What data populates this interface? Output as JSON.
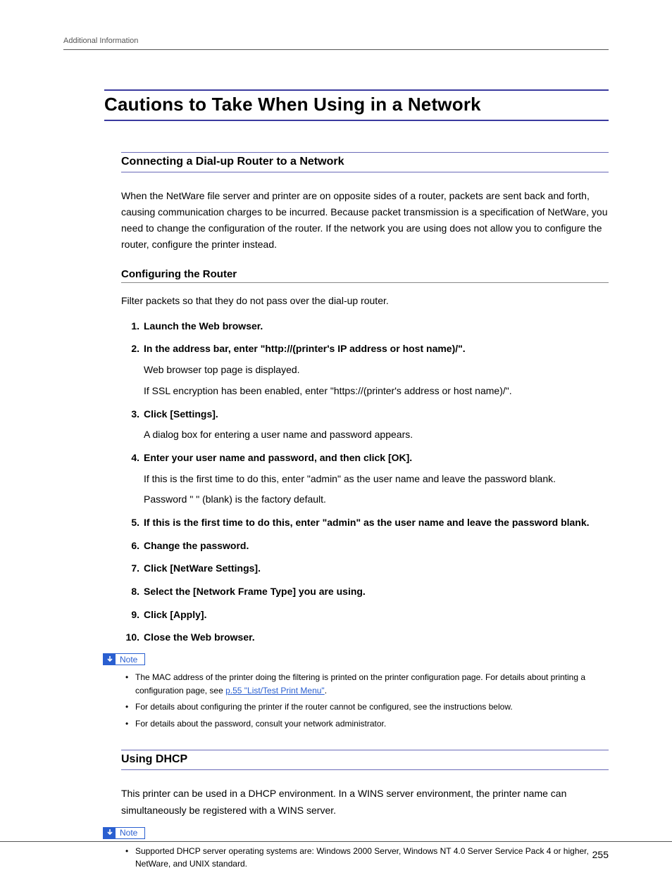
{
  "header": {
    "breadcrumb": "Additional Information"
  },
  "title": "Cautions to Take When Using in a Network",
  "section1": {
    "heading": "Connecting a Dial-up Router to a Network",
    "para": "When the NetWare file server and printer are on opposite sides of a router, packets are sent back and forth, causing communication charges to be incurred. Because packet transmission is a specification of NetWare, you need to change the configuration of the router. If the network you are using does not allow you to configure the router, configure the printer instead."
  },
  "section1sub": {
    "heading": "Configuring the Router",
    "intro": "Filter packets so that they do not pass over the dial-up router.",
    "steps": [
      {
        "head": "Launch the Web browser."
      },
      {
        "head": "In the address bar, enter \"http://(printer's IP address or host name)/\".",
        "subs": [
          "Web browser top page is displayed.",
          "If SSL encryption has been enabled, enter \"https://(printer's address or host name)/\"."
        ]
      },
      {
        "head": "Click [Settings].",
        "subs": [
          "A dialog box for entering a user name and password appears."
        ]
      },
      {
        "head": "Enter your user name and password, and then click [OK].",
        "subs": [
          "If this is the first time to do this, enter \"admin\" as the user name and leave the password blank.",
          "Password \" \" (blank) is the factory default."
        ]
      },
      {
        "head": "If this is the first time to do this, enter \"admin\" as the user name and leave the password blank."
      },
      {
        "head": "Change the password."
      },
      {
        "head": "Click [NetWare Settings]."
      },
      {
        "head": "Select the [Network Frame Type] you are using."
      },
      {
        "head": "Click [Apply]."
      },
      {
        "head": "Close the Web browser."
      }
    ]
  },
  "note_label": "Note",
  "note1": {
    "items": [
      {
        "pre": "The MAC address of the printer doing the filtering is printed on the printer configuration page. For details about printing a configuration page, see ",
        "link": "p.55 \"List/Test Print Menu\"",
        "post": "."
      },
      {
        "text": "For details about configuring the printer if the router cannot be configured, see the instructions below."
      },
      {
        "text": "For details about the password, consult your network administrator."
      }
    ]
  },
  "section2": {
    "heading": "Using DHCP",
    "para": "This printer can be used in a DHCP environment. In a WINS server environment, the printer name can simultaneously be registered with a WINS server."
  },
  "note2": {
    "items": [
      {
        "text": "Supported DHCP server operating systems are: Windows 2000 Server, Windows NT 4.0 Server Service Pack 4 or higher, NetWare, and UNIX standard."
      }
    ]
  },
  "page_number": "255"
}
